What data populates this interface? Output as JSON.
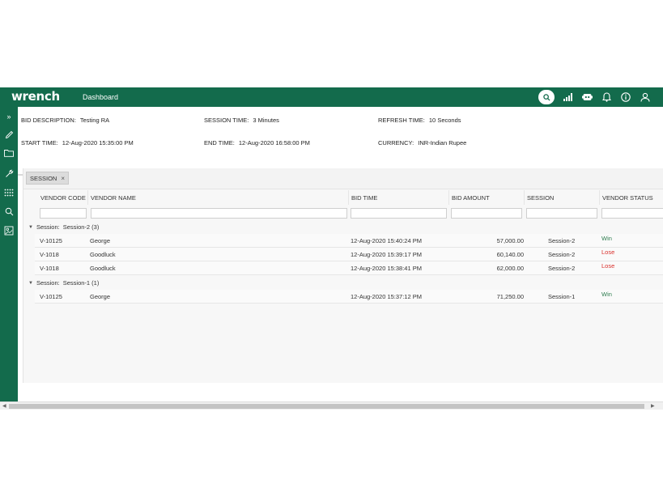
{
  "app": {
    "brand": "wrench",
    "nav_link": "Dashboard"
  },
  "colors": {
    "brand_green": "#136b4c",
    "win": "#2e7d4f",
    "lose": "#d9302c"
  },
  "icons": {
    "top": [
      "search-icon",
      "signal-icon",
      "chatbot-icon",
      "bell-icon",
      "info-icon",
      "user-icon"
    ],
    "sidebar": [
      "expand-icon",
      "pencil-icon",
      "folder-icon",
      "wrench-icon",
      "apps-grid-icon",
      "search-icon",
      "report-icon"
    ]
  },
  "info": {
    "bid_description": {
      "label": "BID DESCRIPTION:",
      "value": "Testing RA"
    },
    "session_time": {
      "label": "SESSION TIME:",
      "value": "3  Minutes"
    },
    "refresh_time": {
      "label": "REFRESH TIME:",
      "value": "10  Seconds"
    },
    "start_time": {
      "label": "START TIME:",
      "value": "12-Aug-2020 15:35:00 PM"
    },
    "end_time": {
      "label": "END TIME:",
      "value": "12-Aug-2020 16:58:00 PM"
    },
    "currency": {
      "label": "CURRENCY:",
      "value": "INR-Indian Rupee"
    }
  },
  "grid": {
    "group_chip": "SESSION",
    "group_chip_close": "×",
    "columns": [
      "VENDOR CODE",
      "VENDOR NAME",
      "BID TIME",
      "BID AMOUNT",
      "SESSION",
      "VENDOR STATUS"
    ],
    "groups": [
      {
        "label": "Session:",
        "value": "Session-2 (3)",
        "rows": [
          {
            "vendor_code": "V-10125",
            "vendor_name": "George",
            "bid_time": "12-Aug-2020 15:40:24 PM",
            "bid_amount": "57,000.00",
            "session": "Session-2",
            "status": "Win"
          },
          {
            "vendor_code": "V-1018",
            "vendor_name": "Goodluck",
            "bid_time": "12-Aug-2020 15:39:17 PM",
            "bid_amount": "60,140.00",
            "session": "Session-2",
            "status": "Lose"
          },
          {
            "vendor_code": "V-1018",
            "vendor_name": "Goodluck",
            "bid_time": "12-Aug-2020 15:38:41 PM",
            "bid_amount": "62,000.00",
            "session": "Session-2",
            "status": "Lose"
          }
        ]
      },
      {
        "label": "Session:",
        "value": "Session-1 (1)",
        "rows": [
          {
            "vendor_code": "V-10125",
            "vendor_name": "George",
            "bid_time": "12-Aug-2020 15:37:12 PM",
            "bid_amount": "71,250.00",
            "session": "Session-1",
            "status": "Win"
          }
        ]
      }
    ]
  }
}
